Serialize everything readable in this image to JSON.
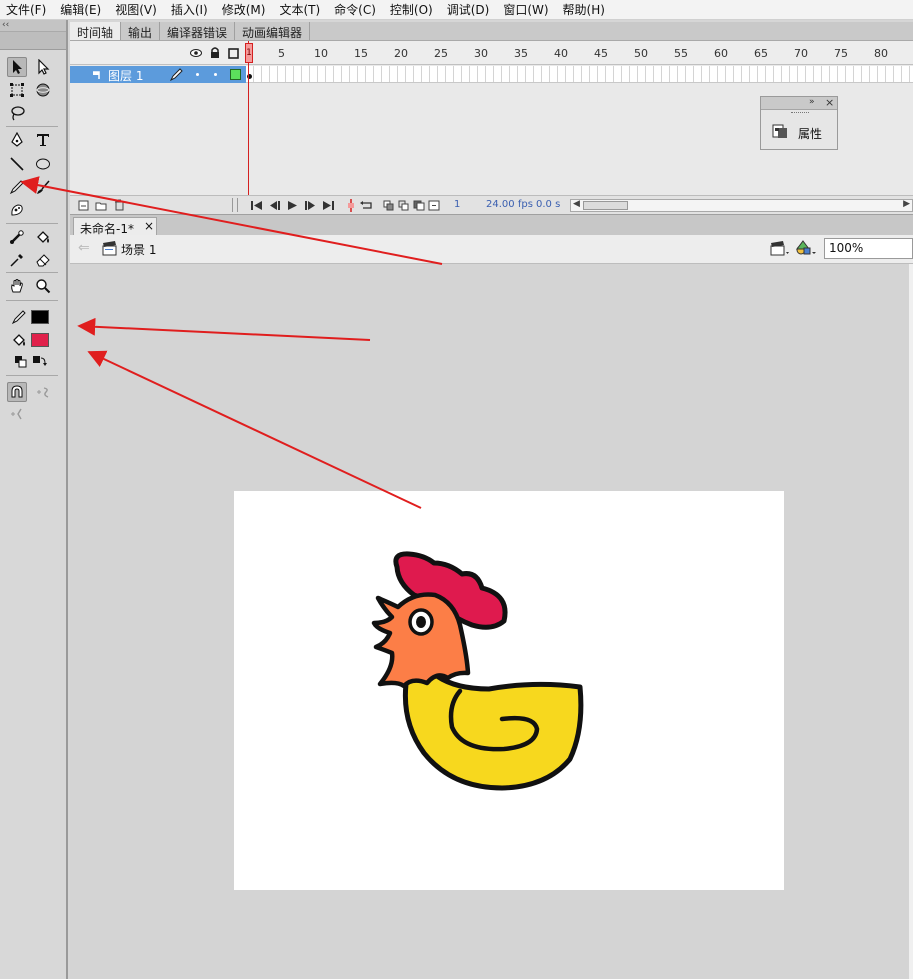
{
  "menu": [
    "文件(F)",
    "编辑(E)",
    "视图(V)",
    "插入(I)",
    "修改(M)",
    "文本(T)",
    "命令(C)",
    "控制(O)",
    "调试(D)",
    "窗口(W)",
    "帮助(H)"
  ],
  "tools_collapse_glyph": "‹‹",
  "panel_tabs": [
    "时间轴",
    "输出",
    "编译器错误",
    "动画编辑器"
  ],
  "timeline": {
    "frame_numbers": [
      "1",
      "5",
      "10",
      "15",
      "20",
      "25",
      "30",
      "35",
      "40",
      "45",
      "50",
      "55",
      "60",
      "65",
      "70",
      "75",
      "80"
    ],
    "layer_name": "图层 1",
    "current_frame": "1",
    "fps": "24.00",
    "fps_unit": "fps",
    "elapsed": "0.0",
    "elapsed_unit": "s"
  },
  "properties_panel": {
    "label": "属性"
  },
  "document": {
    "tab_title": "未命名-1*",
    "tab_close": "×",
    "scene": "场景 1",
    "zoom": "100%"
  },
  "colors": {
    "stroke_color": "#000000",
    "fill_color": "#e0204a",
    "annotation_arrow": "#e01e1e",
    "layer_highlight": "#5c9bdc"
  },
  "icons": [
    "selection-tool-icon",
    "subselection-tool-icon",
    "free-transform-icon",
    "3d-rotation-icon",
    "lasso-icon",
    "pen-icon",
    "text-icon",
    "line-icon",
    "oval-icon",
    "pencil-icon",
    "brush-icon",
    "deco-icon",
    "bone-icon",
    "paint-bucket-icon",
    "eyedropper-icon",
    "eraser-icon",
    "hand-icon",
    "zoom-icon",
    "stroke-color-icon",
    "fill-color-icon",
    "swap-colors-icon",
    "snap-magnet-icon",
    "smooth-icon",
    "straighten-icon"
  ]
}
